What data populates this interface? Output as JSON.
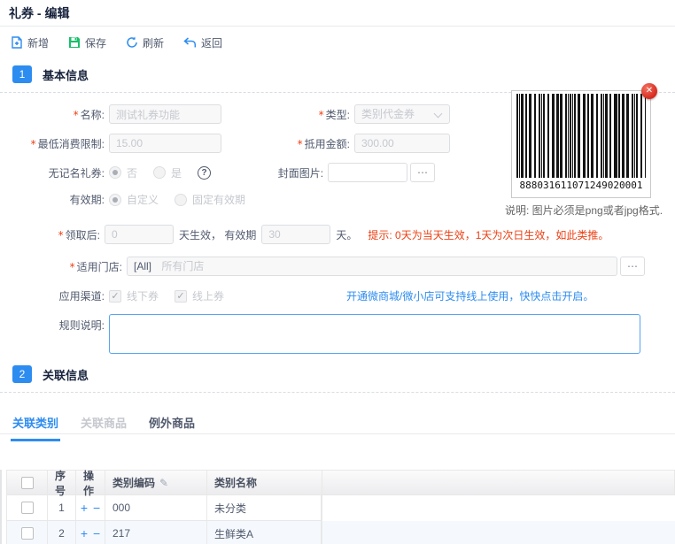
{
  "page": {
    "title": "礼券 - 编辑"
  },
  "toolbar": {
    "new": "新增",
    "save": "保存",
    "refresh": "刷新",
    "back": "返回"
  },
  "accent_color": "#2d8cf0",
  "save_icon_color": "#19be6b",
  "sections": {
    "basic": {
      "num": "1",
      "title": "基本信息"
    },
    "related": {
      "num": "2",
      "title": "关联信息"
    }
  },
  "form": {
    "name": {
      "label": "名称:",
      "value": "测试礼券功能"
    },
    "type": {
      "label": "类型:",
      "value": "类别代金券"
    },
    "min_spend": {
      "label": "最低消费限制:",
      "value": "15.00"
    },
    "deduct_amount": {
      "label": "抵用金额:",
      "value": "300.00"
    },
    "bearer": {
      "label": "无记名礼券:",
      "option_no": "否",
      "option_yes": "是",
      "help_icon": "question-circle"
    },
    "cover": {
      "label": "封面图片:",
      "value": "",
      "browse": "⋯"
    },
    "validity": {
      "label": "有效期:",
      "option_custom": "自定义",
      "option_fixed": "固定有效期"
    },
    "after_receive": {
      "label": "领取后:",
      "days_effective": "0",
      "mid_text": "天生效， 有效期",
      "days_valid": "30",
      "suffix_text": "天。",
      "hint": "提示: 0天为当天生效，1天为次日生效，如此类推。"
    },
    "stores": {
      "label": "适用门店:",
      "tag": "[All]",
      "placeholder": "所有门店",
      "browse": "⋯"
    },
    "channels": {
      "label": "应用渠道:",
      "offline": "线下券",
      "online": "线上券",
      "check_glyph": "✓",
      "link": "开通微商城/微小店可支持线上使用，快快点击开启。"
    },
    "rules": {
      "label": "规则说明:",
      "value": ""
    }
  },
  "barcode": {
    "number": "888031611071249020001",
    "close_glyph": "✕",
    "note": "说明: 图片必须是png或者jpg格式."
  },
  "tabs": [
    {
      "label": "关联类别",
      "state": "active"
    },
    {
      "label": "关联商品",
      "state": "disabled"
    },
    {
      "label": "例外商品",
      "state": "normal"
    }
  ],
  "table": {
    "headers": {
      "no": "序号",
      "op": "操作",
      "code": "类别编码",
      "name": "类别名称"
    },
    "edit_icon": "✎",
    "op_plus": "+",
    "op_minus": "−",
    "rows": [
      {
        "no": "1",
        "code": "000",
        "name": "未分类"
      },
      {
        "no": "2",
        "code": "217",
        "name": "生鲜类A"
      }
    ]
  }
}
